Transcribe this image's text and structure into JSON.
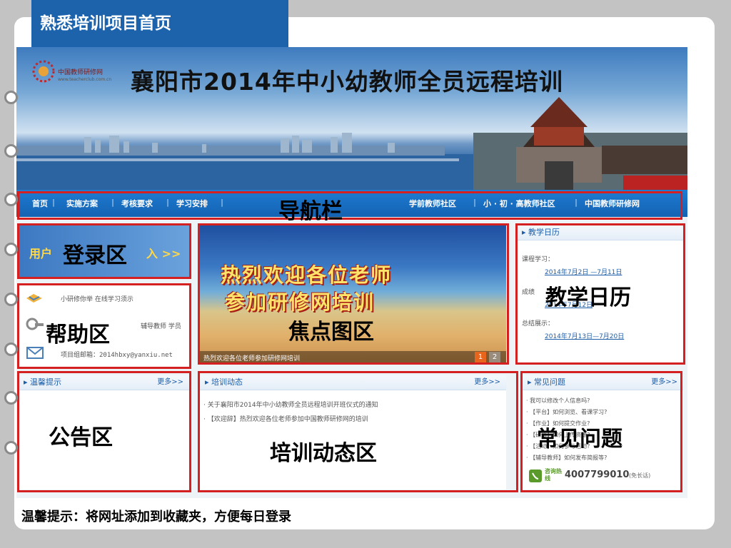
{
  "slide": {
    "title": "熟悉培训项目首页",
    "bottom_tip": "温馨提示：将网址添加到收藏夹，方便每日登录"
  },
  "banner": {
    "logo_name": "中国教师研修网",
    "logo_url_text": "www.teacherclub.com.cn",
    "title": "襄阳市2014年中小幼教师全员远程培训"
  },
  "nav": {
    "left": [
      "首页",
      "实施方案",
      "考核要求",
      "学习安排"
    ],
    "right": [
      "学前教师社区",
      "小 · 初 · 高教师社区",
      "中国教师研修网"
    ],
    "overlay": "导航栏"
  },
  "login": {
    "text_left": "用户",
    "text_right": "入 >>",
    "overlay": "登录区"
  },
  "help": {
    "row1": "小研修你举  在线学习须示",
    "row2": "辅导教师  学员",
    "row3": "项目组邮箱：2014hbxy@yanxiu.net",
    "overlay": "帮助区"
  },
  "focus": {
    "line1": "热烈欢迎各位老师",
    "line2": "参加研修网培训",
    "caption": "热烈欢迎各位老师参加研修网培训",
    "pages": [
      "1",
      "2"
    ],
    "overlay": "焦点图区"
  },
  "calendar": {
    "header": "教学日历",
    "item1_label": "课程学习：",
    "item1_date": "2014年7月2日 —7月11日",
    "item2_label": "成绩",
    "item2_date": "2014年7月12日",
    "item3_label": "总结展示：",
    "item3_date": "2014年7月13日—7月20日",
    "overlay": "教学日历"
  },
  "notice": {
    "header": "温馨提示",
    "more": "更多>>",
    "overlay": "公告区"
  },
  "news": {
    "header": "培训动态",
    "more": "更多>>",
    "items": [
      "关于襄阳市2014年中小幼教师全员远程培训开班仪式的通知",
      "【欢迎辞】热烈欢迎各位老师参加中国教师研修网的培训"
    ],
    "overlay": "培训动态区"
  },
  "faq": {
    "header": "常见问题",
    "more": "更多>>",
    "items": [
      "· 我可以修改个人信息吗?",
      "· 【平台】如何浏览、看课学习?",
      "· 【作业】如何提交作业?",
      "· 【研修】如何上传资源?",
      "· 【活动】如何参与活动?",
      "· 【辅导教师】如何发布简报等?"
    ],
    "hotline_label": "咨询热线",
    "hotline": "4007799010",
    "hotline_note": "(免长话)",
    "overlay": "常见问题"
  }
}
